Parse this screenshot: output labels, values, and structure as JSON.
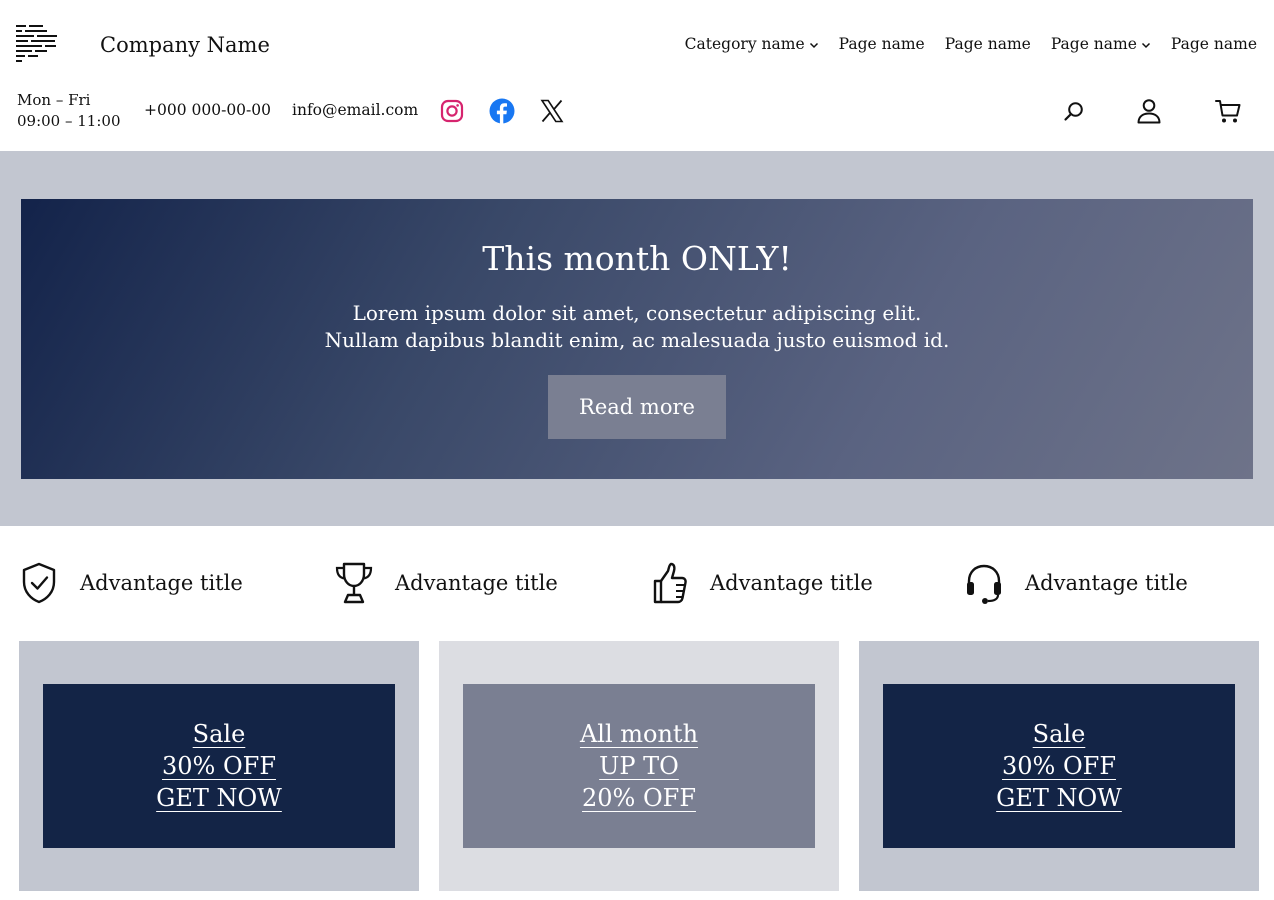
{
  "header": {
    "company_name": "Company Name",
    "logo_icon": "menu-lines-logo",
    "nav": [
      {
        "label": "Category name",
        "has_dropdown": true
      },
      {
        "label": "Page name",
        "has_dropdown": false
      },
      {
        "label": "Page name",
        "has_dropdown": false
      },
      {
        "label": "Page name",
        "has_dropdown": true
      },
      {
        "label": "Page name",
        "has_dropdown": false
      }
    ],
    "hours_days": "Mon – Fri",
    "hours_time": "09:00 – 11:00",
    "phone": "+000 000-00-00",
    "email": "info@email.com",
    "social": [
      "instagram-icon",
      "facebook-icon",
      "x-icon"
    ],
    "tools": [
      "search-icon",
      "user-icon",
      "cart-icon"
    ]
  },
  "hero": {
    "title": "This month ONLY!",
    "text_line1": "Lorem ipsum dolor sit amet, consectetur adipiscing elit.",
    "text_line2": "Nullam dapibus blandit enim, ac malesuada justo euismod id.",
    "button_label": "Read more"
  },
  "advantages": [
    {
      "icon": "shield-check-icon",
      "title": "Advantage title"
    },
    {
      "icon": "trophy-icon",
      "title": "Advantage title"
    },
    {
      "icon": "thumbs-up-icon",
      "title": "Advantage title"
    },
    {
      "icon": "headset-icon",
      "title": "Advantage title"
    }
  ],
  "promos": [
    {
      "lines": [
        "Sale",
        "30% OFF",
        "GET NOW"
      ],
      "outer_color": "#c2c6d0",
      "inner_color": "#132446"
    },
    {
      "lines": [
        "All month",
        "UP TO",
        "20% OFF"
      ],
      "outer_color": "#dcdde2",
      "inner_color": "#7a7f92"
    },
    {
      "lines": [
        "Sale",
        "30% OFF",
        "GET NOW"
      ],
      "outer_color": "#c2c6d0",
      "inner_color": "#132446"
    }
  ],
  "colors": {
    "navy": "#132446",
    "band": "#c2c6d0",
    "slate": "#7a7f92",
    "instagram": "#d6246e",
    "facebook": "#1877f2"
  }
}
